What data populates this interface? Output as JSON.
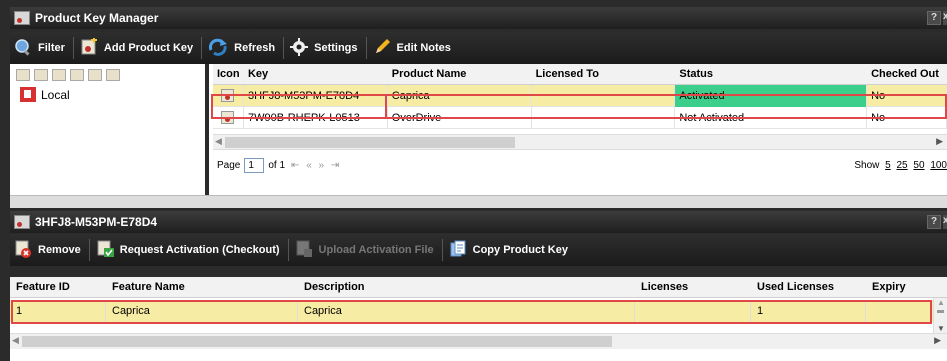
{
  "app": {
    "title": "Product Key Manager",
    "help_btn": "?",
    "close_btn": "x"
  },
  "toolbar": {
    "filter": "Filter",
    "add_key": "Add Product Key",
    "refresh": "Refresh",
    "settings": "Settings",
    "edit_notes": "Edit Notes"
  },
  "tree": {
    "local": "Local"
  },
  "grid": {
    "columns": [
      "Icon",
      "Key",
      "Product Name",
      "Licensed To",
      "Status",
      "Checked Out"
    ],
    "rows": [
      {
        "key": "3HFJ8-M53PM-E78D4",
        "product": "Caprica",
        "licensed_to": "",
        "status": "Activated",
        "checked_out": "No"
      },
      {
        "key": "7W90B-RHEPK-L0513",
        "product": "OverDrive",
        "licensed_to": "",
        "status": "Not Activated",
        "checked_out": "No"
      }
    ],
    "pager": {
      "page_label": "Page",
      "page_value": "1",
      "of_label": "of 1",
      "nav": "⇤ « » ⇥",
      "show_label": "Show",
      "sizes": [
        "5",
        "25",
        "50",
        "100"
      ]
    }
  },
  "detail": {
    "title": "3HFJ8-M53PM-E78D4",
    "toolbar": {
      "remove": "Remove",
      "request_activation": "Request Activation (Checkout)",
      "upload_activation": "Upload Activation File",
      "copy_key": "Copy Product Key"
    },
    "columns": [
      "Feature ID",
      "Feature Name",
      "Description",
      "Licenses",
      "Used Licenses",
      "Expiry"
    ],
    "rows": [
      {
        "feature_id": "1",
        "feature_name": "Caprica",
        "description": "Caprica",
        "licenses": "",
        "used": "1",
        "expiry": ""
      }
    ]
  },
  "colors": {
    "selected_row": "#f7eca4",
    "activated": "#3ccf8b",
    "highlight_border": "#e04848"
  }
}
